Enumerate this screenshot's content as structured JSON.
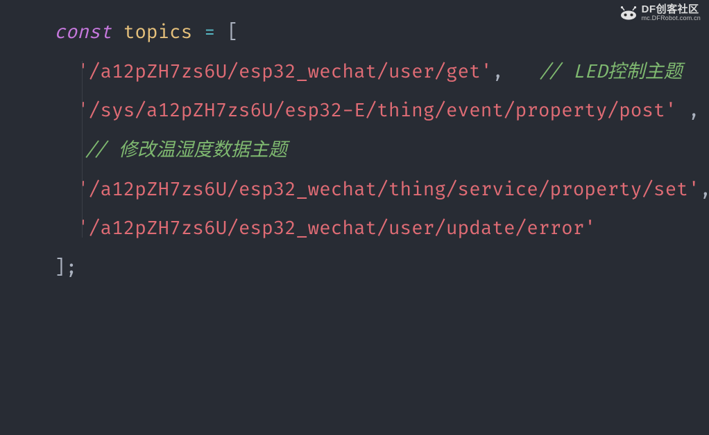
{
  "code": {
    "kw_const": "const",
    "var_name": "topics",
    "op_assign": "=",
    "bracket_open": "[",
    "bracket_close": "]",
    "semicolon": ";",
    "comma": ",",
    "line1_str": "'/a12pZH7zs6U/esp32_wechat/user/get'",
    "line1_cmt": "// LED控制主题",
    "line2_str": "'/sys/a12pZH7zs6U/esp32-E/thing/event/property/post'",
    "line2_cmt": "// 修改温湿度数据主题",
    "line3_str": "'/a12pZH7zs6U/esp32_wechat/thing/service/property/set'",
    "line4_str": "'/a12pZH7zs6U/esp32_wechat/user/update/error'"
  },
  "watermark": {
    "title": "DF创客社区",
    "sub": "mc.DFRobot.com.cn"
  }
}
